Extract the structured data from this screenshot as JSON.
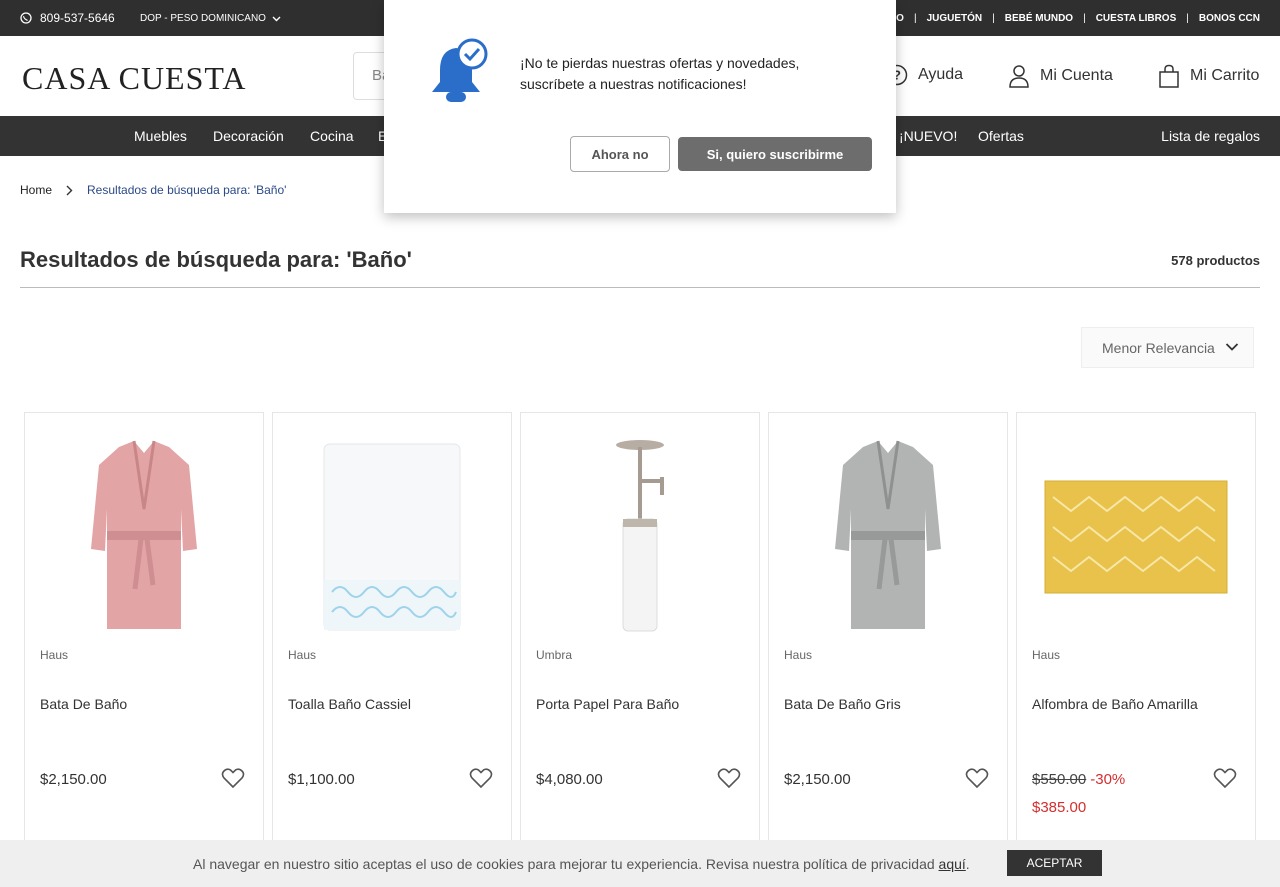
{
  "topbar": {
    "phone": "809-537-5646",
    "currency": "DOP - PESO DOMINICANO",
    "links": [
      "MBO",
      "JUGUETÓN",
      "BEBÉ MUNDO",
      "CUESTA LIBROS",
      "BONOS CCN"
    ]
  },
  "header": {
    "logo": "CASA CUESTA",
    "search_value": "Ba",
    "help": "Ayuda",
    "account": "Mi Cuenta",
    "cart": "Mi Carrito"
  },
  "nav": {
    "items": [
      "Muebles",
      "Decoración",
      "Cocina",
      "E",
      "¡NUEVO!",
      "Ofertas"
    ],
    "gift_list": "Lista de regalos"
  },
  "breadcrumb": {
    "home": "Home",
    "current": "Resultados de búsqueda para: 'Baño'"
  },
  "results": {
    "title": "Resultados de búsqueda para: 'Baño'",
    "count": "578 productos",
    "sort": "Menor Relevancia"
  },
  "products": [
    {
      "brand": "Haus",
      "name": "Bata De Baño",
      "price": "$2,150.00"
    },
    {
      "brand": "Haus",
      "name": "Toalla Baño Cassiel",
      "price": "$1,100.00"
    },
    {
      "brand": "Umbra",
      "name": "Porta Papel Para Baño",
      "price": "$4,080.00"
    },
    {
      "brand": "Haus",
      "name": "Bata De Baño Gris",
      "price": "$2,150.00"
    },
    {
      "brand": "Haus",
      "name": "Alfombra de Baño Amarilla",
      "price": "$550.00",
      "discount": "-30%",
      "sale_price": "$385.00"
    }
  ],
  "popup": {
    "message": "¡No te pierdas nuestras ofertas y novedades, suscríbete a nuestras notificaciones!",
    "later": "Ahora no",
    "subscribe": "Si, quiero suscribirme"
  },
  "cookie": {
    "text": "Al navegar en nuestro sitio aceptas el uso de cookies para mejorar tu experiencia. Revisa nuestra política de privacidad ",
    "link": "aquí",
    "period": ".",
    "accept": "ACEPTAR"
  }
}
